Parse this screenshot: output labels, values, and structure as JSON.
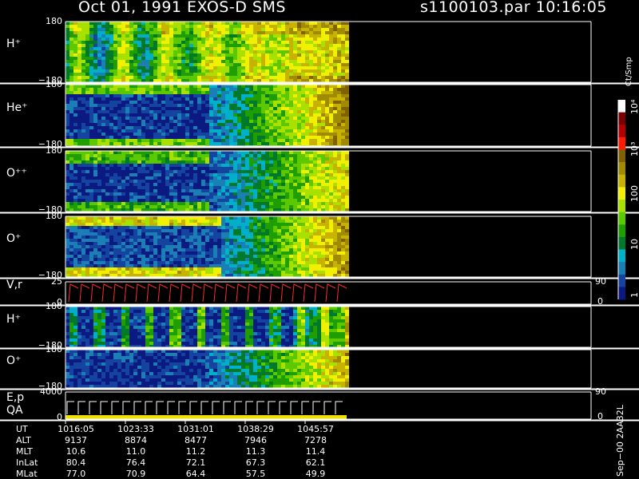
{
  "header": {
    "title": "Oct 01, 1991    EXOS-D SMS",
    "file": "s1100103.par  10:16:05"
  },
  "colorbar": {
    "unit": "Ct/Smp",
    "ticks": [
      "10⁴",
      "10³",
      "100",
      "10",
      "1"
    ],
    "colors": [
      "#ffffff",
      "#7a0000",
      "#b30000",
      "#ff1a00",
      "#806000",
      "#a08a00",
      "#c7b200",
      "#f0f000",
      "#a8e000",
      "#5cc800",
      "#1e9e00",
      "#007a2a",
      "#00b0c8",
      "#1a7fb5",
      "#1544a0",
      "#0a1a80"
    ]
  },
  "panels": [
    {
      "label": "H⁺",
      "ymax": "180",
      "ymin": "−180"
    },
    {
      "label": "He⁺",
      "ymax": "180",
      "ymin": "−180"
    },
    {
      "label": "O⁺⁺",
      "ymax": "180",
      "ymin": "−180"
    },
    {
      "label": "O⁺",
      "ymax": "180",
      "ymin": "−180"
    },
    {
      "label": "V,r",
      "ymax": "25",
      "ymin": "0",
      "rmax": "90",
      "rmin": "0"
    },
    {
      "label": "H⁺",
      "ymax": "180",
      "ymin": "−180"
    },
    {
      "label": "O⁺",
      "ymax": "180",
      "ymin": "−180"
    },
    {
      "label": "E,p\nQA",
      "ymax": "4000",
      "ymin": "0",
      "rmax": "90",
      "rmin": "0"
    }
  ],
  "side_label": "Sep−00  2AA32L",
  "ephemeris": {
    "rows": [
      "UT",
      "ALT",
      "MLT",
      "InLat",
      "MLat"
    ],
    "columns": [
      [
        "1016:05",
        "9137",
        "10.6",
        "80.4",
        "77.0"
      ],
      [
        "1023:33",
        "8874",
        "11.0",
        "76.4",
        "70.9"
      ],
      [
        "1031:01",
        "8477",
        "11.2",
        "72.1",
        "64.4"
      ],
      [
        "1038:29",
        "7946",
        "11.3",
        "67.3",
        "57.5"
      ],
      [
        "1045:57",
        "7278",
        "11.4",
        "62.1",
        "49.9"
      ]
    ]
  },
  "chart_data": {
    "type": "heatmap",
    "x": [
      "1016:05",
      "1023:33",
      "1031:01",
      "1038:29",
      "1045:57"
    ],
    "ylim": [
      -180,
      180
    ],
    "colorbar_range": [
      1,
      10000
    ]
  }
}
